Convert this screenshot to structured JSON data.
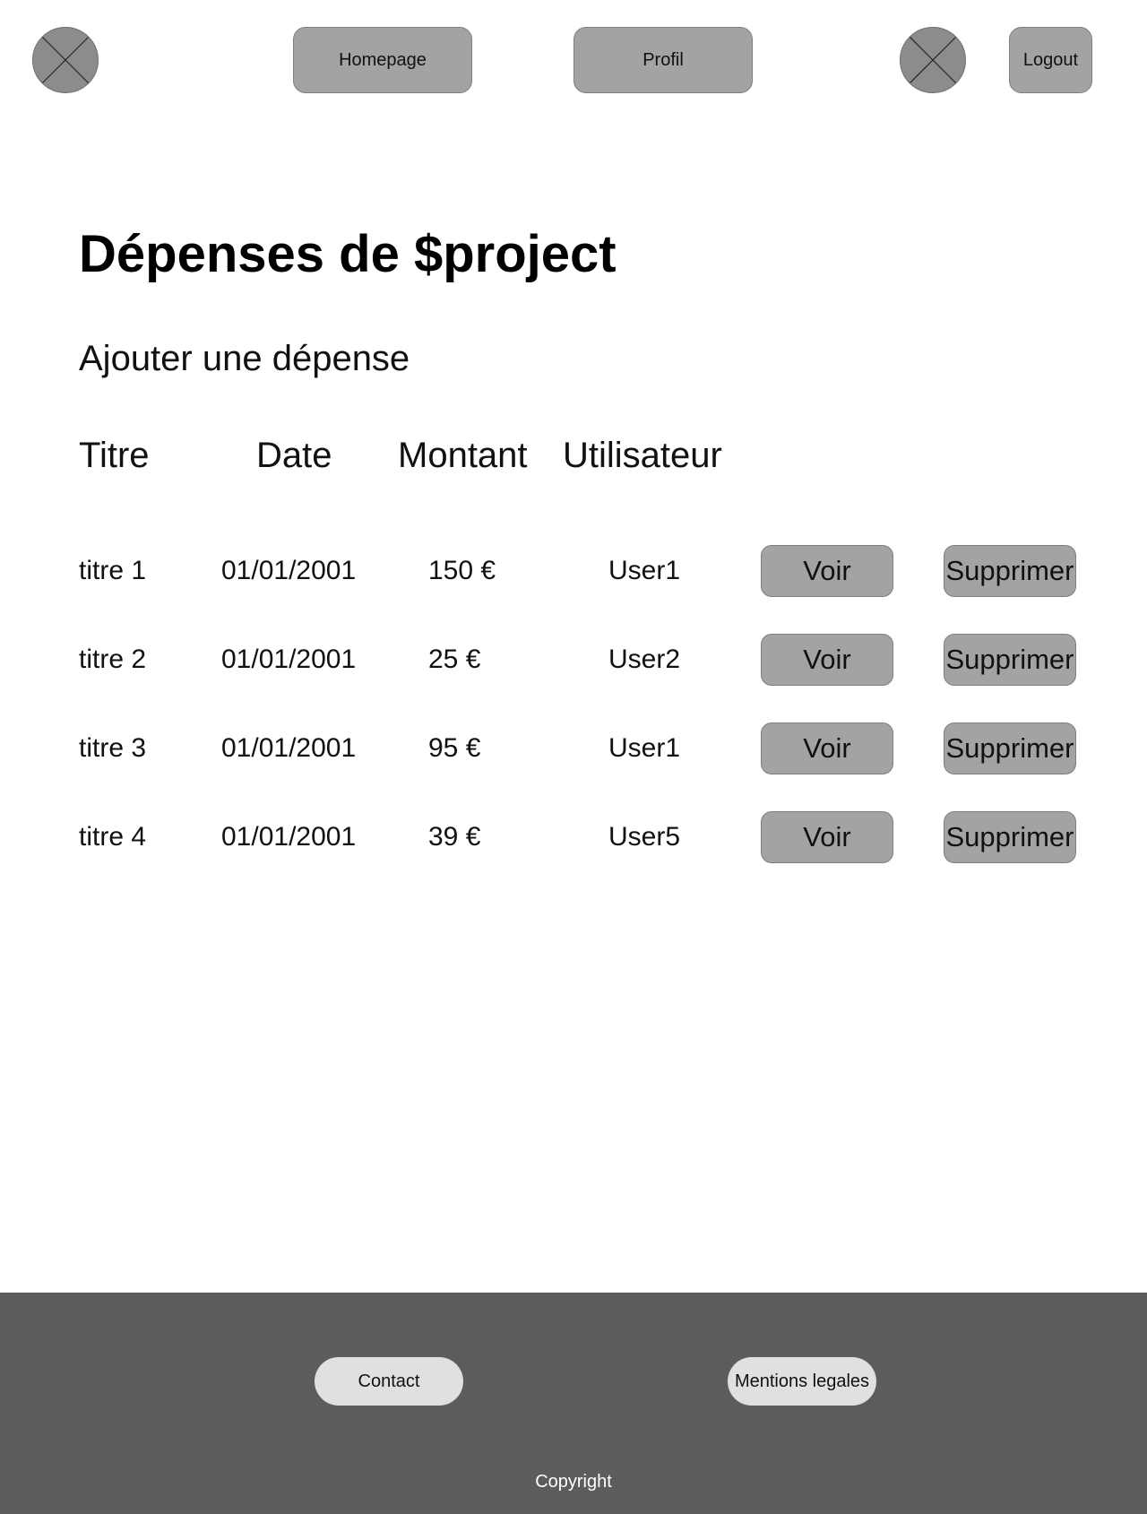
{
  "header": {
    "nav": {
      "homepage": "Homepage",
      "profil": "Profil",
      "logout": "Logout"
    }
  },
  "main": {
    "title": "Dépenses de $project",
    "add_expense": "Ajouter une dépense",
    "columns": [
      "Titre",
      "Date",
      "Montant",
      "Utilisateur"
    ],
    "rows": [
      {
        "titre": "titre 1",
        "date": "01/01/2001",
        "montant": "150 €",
        "utilisateur": "User1",
        "view": "Voir",
        "delete": "Supprimer"
      },
      {
        "titre": "titre 2",
        "date": "01/01/2001",
        "montant": "25 €",
        "utilisateur": "User2",
        "view": "Voir",
        "delete": "Supprimer"
      },
      {
        "titre": "titre 3",
        "date": "01/01/2001",
        "montant": "95 €",
        "utilisateur": "User1",
        "view": "Voir",
        "delete": "Supprimer"
      },
      {
        "titre": "titre 4",
        "date": "01/01/2001",
        "montant": "39 €",
        "utilisateur": "User5",
        "view": "Voir",
        "delete": "Supprimer"
      }
    ]
  },
  "footer": {
    "contact": "Contact",
    "mentions": "Mentions legales",
    "copyright": "Copyright"
  },
  "icons": {
    "logo": "image-placeholder-icon",
    "avatar": "image-placeholder-icon"
  },
  "colors": {
    "button_bg": "#a3a3a3",
    "footer_bg": "#5c5c5c",
    "footer_button_bg": "#e0e0e0"
  }
}
